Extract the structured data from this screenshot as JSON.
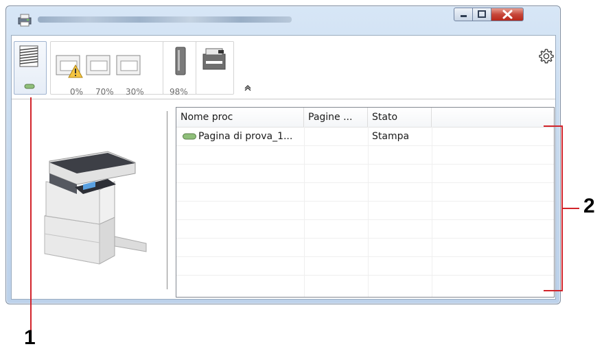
{
  "window": {
    "controls": {
      "minimize": "minimize",
      "maximize": "maximize",
      "close": "close"
    }
  },
  "toolbar": {
    "paper_levels": [
      "0%",
      "70%",
      "30%"
    ],
    "toner_level": "98%"
  },
  "job_table": {
    "columns": [
      "Nome proc",
      "Pagine ...",
      "Stato"
    ],
    "rows": [
      {
        "name": "Pagina di prova_1...",
        "pages": "",
        "status": "Stampa"
      }
    ]
  },
  "callouts": {
    "one": "1",
    "two": "2"
  },
  "colors": {
    "callout": "#d2232a",
    "job_indicator": "#8fbf7a"
  },
  "icons": [
    "printer-app-icon",
    "job-list-icon",
    "paper-tray-icon",
    "warning-icon",
    "toner-icon",
    "device-icon",
    "settings-gear-icon",
    "chevron-up-icon",
    "job-status-icon"
  ]
}
